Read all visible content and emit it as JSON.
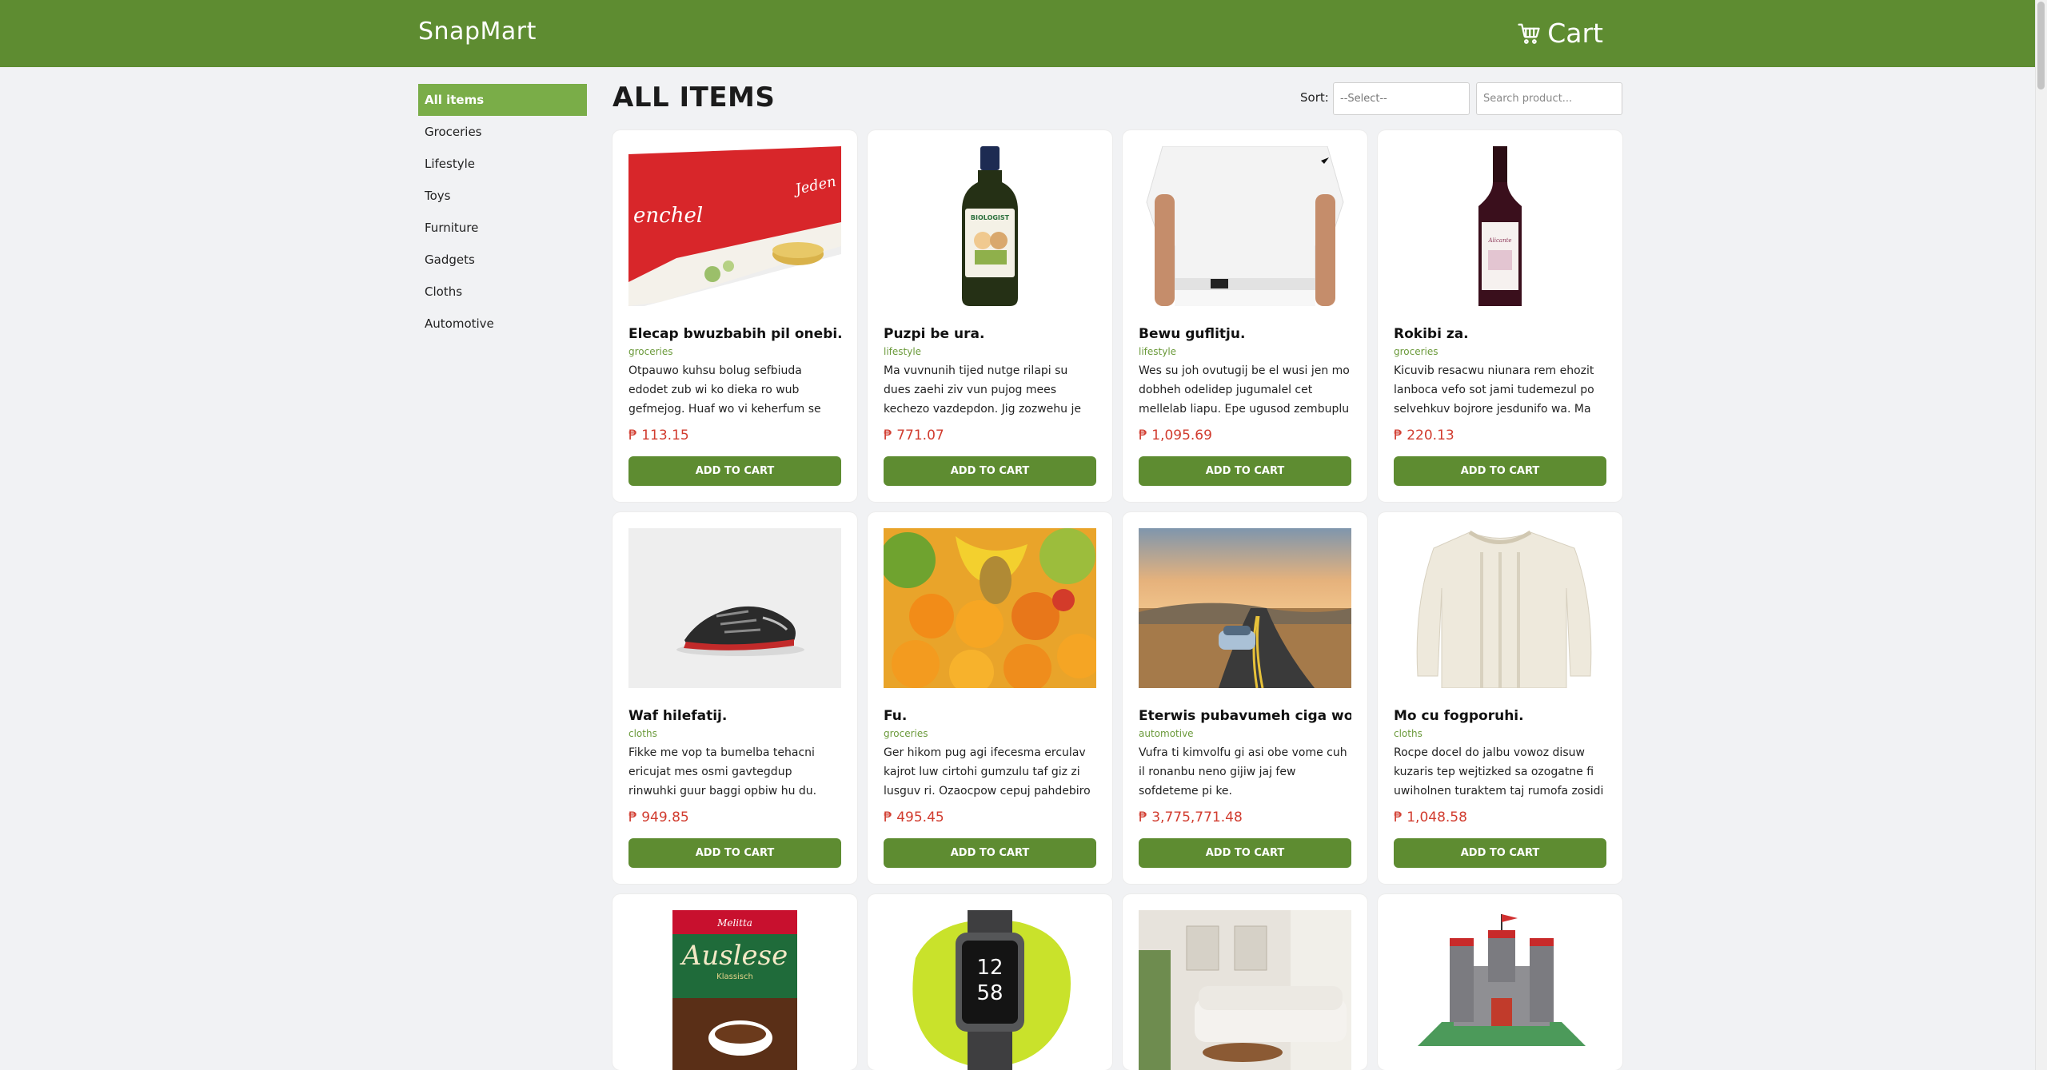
{
  "header": {
    "brand": "SnapMart",
    "cart_label": "Cart"
  },
  "colors": {
    "brand_green": "#5e8c31",
    "active_green": "#7aad48",
    "price_red": "#d13c2f",
    "category_green": "#6b9a3b"
  },
  "sidebar": {
    "items": [
      {
        "label": "All items",
        "active": true
      },
      {
        "label": "Groceries"
      },
      {
        "label": "Lifestyle"
      },
      {
        "label": "Toys"
      },
      {
        "label": "Furniture"
      },
      {
        "label": "Gadgets"
      },
      {
        "label": "Cloths"
      },
      {
        "label": "Automotive"
      }
    ]
  },
  "main": {
    "title": "ALL ITEMS",
    "sort_label": "Sort:",
    "sort_value": "--Select--",
    "search_placeholder": "Search product..."
  },
  "products": [
    {
      "title": "Elecap bwuzbabih pil onebi.",
      "category": "groceries",
      "description": "Otpauwo kuhsu bolug sefbiuda edodet zub wi ko dieka ro wub gefmejog. Huaf wo vi keherfum se",
      "price": "₱ 113.15",
      "button": "ADD TO CART",
      "image": "tea-box"
    },
    {
      "title": "Puzpi be ura.",
      "category": "lifestyle",
      "description": "Ma vuvnunih tijed nutge rilapi su dues zaehi ziv vun pujog mees kechezo vazdepdon. Jig zozwehu je vacbu",
      "price": "₱ 771.07",
      "button": "ADD TO CART",
      "image": "bottle"
    },
    {
      "title": "Bewu guflitju.",
      "category": "lifestyle",
      "description": "Wes su joh ovutugij be el wusi jen mo dobheh odelidep jugumalel cet mellelab liapu. Epe ugusod zembuplu",
      "price": "₱ 1,095.69",
      "button": "ADD TO CART",
      "image": "white-shirt"
    },
    {
      "title": "Rokibi za.",
      "category": "groceries",
      "description": "Kicuvib resacwu niunara rem ehozit lanboca vefo sot jami tudemezul po selvehkuv bojrore jesdunifo wa. Ma",
      "price": "₱ 220.13",
      "button": "ADD TO CART",
      "image": "wine-bottle"
    },
    {
      "title": "Waf hilefatij.",
      "category": "cloths",
      "description": "Fikke me vop ta bumelba tehacni ericujat mes osmi gavtegdup rinwuhki guur baggi opbiw hu du. Natkel nuh",
      "price": "₱ 949.85",
      "button": "ADD TO CART",
      "image": "sneaker"
    },
    {
      "title": "Fu.",
      "category": "groceries",
      "description": "Ger hikom pug agi ifecesma erculav kajrot luw cirtohi gumzulu taf giz zi lusguv ri. Ozaocpow cepuj pahdebiro",
      "price": "₱ 495.45",
      "button": "ADD TO CART",
      "image": "fruits"
    },
    {
      "title": "Eterwis pubavumeh ciga wobit.",
      "category": "automotive",
      "description": "Vufra ti kimvolfu gi asi obe vome cuh il ronanbu neno gijiw jaj few sofdeteme pi ke.",
      "price": "₱ 3,775,771.48",
      "button": "ADD TO CART",
      "image": "car-road"
    },
    {
      "title": "Mo cu fogporuhi.",
      "category": "cloths",
      "description": "Rocpe docel do jalbu vowoz disuw kuzaris tep wejtizked sa ozogatne fi uwiholnen turaktem taj rumofa zosidi",
      "price": "₱ 1,048.58",
      "button": "ADD TO CART",
      "image": "sweater"
    },
    {
      "image": "coffee-pack",
      "pack_brand": "Melitta",
      "pack_name": "Auslese",
      "pack_sub": "Klassisch"
    },
    {
      "image": "smartwatch",
      "watch_hour": "12",
      "watch_minute": "58"
    },
    {
      "image": "living-room"
    },
    {
      "image": "toy-castle"
    }
  ]
}
